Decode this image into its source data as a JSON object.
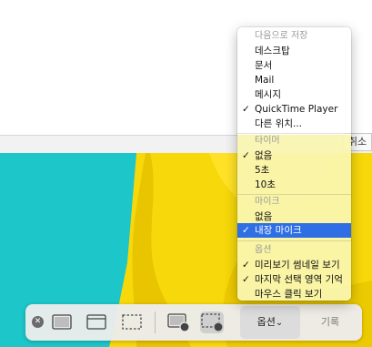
{
  "header": {
    "cancel_label": "취소"
  },
  "options_menu": {
    "save_to": {
      "header": "다음으로 저장",
      "items": [
        {
          "label": "데스크탑",
          "checked": false
        },
        {
          "label": "문서",
          "checked": false
        },
        {
          "label": "Mail",
          "checked": false
        },
        {
          "label": "메시지",
          "checked": false
        },
        {
          "label": "QuickTime Player",
          "checked": true
        },
        {
          "label": "다른 위치...",
          "checked": false
        }
      ]
    },
    "timer": {
      "header": "타이머",
      "items": [
        {
          "label": "없음",
          "checked": true
        },
        {
          "label": "5초",
          "checked": false
        },
        {
          "label": "10초",
          "checked": false
        }
      ]
    },
    "microphone": {
      "header": "마이크",
      "items": [
        {
          "label": "없음",
          "checked": false
        },
        {
          "label": "내장 마이크",
          "checked": true,
          "highlighted": true
        }
      ]
    },
    "options": {
      "header": "옵션",
      "items": [
        {
          "label": "미리보기 썸네일 보기",
          "checked": true
        },
        {
          "label": "마지막 선택 영역 기억",
          "checked": true
        },
        {
          "label": "마우스 클릭 보기",
          "checked": false
        }
      ]
    },
    "check_mark": "✓"
  },
  "toolbar": {
    "close_glyph": "✕",
    "tools": [
      {
        "name": "capture-entire-screen",
        "icon": "screen-icon",
        "active": false
      },
      {
        "name": "capture-selected-window",
        "icon": "window-icon",
        "active": false
      },
      {
        "name": "capture-selected-portion",
        "icon": "dashed-rect-icon",
        "active": false
      },
      {
        "name": "record-entire-screen",
        "icon": "screen-record-icon",
        "active": false
      },
      {
        "name": "record-selected-portion",
        "icon": "dashed-record-icon",
        "active": true
      }
    ],
    "options_label": "옵션",
    "options_chevron": "⌄",
    "record_label": "기록"
  },
  "colors": {
    "highlight": "#2f6fe5",
    "photo_cyan": "#1cc6c9",
    "photo_yellow": "#f7d80a"
  }
}
